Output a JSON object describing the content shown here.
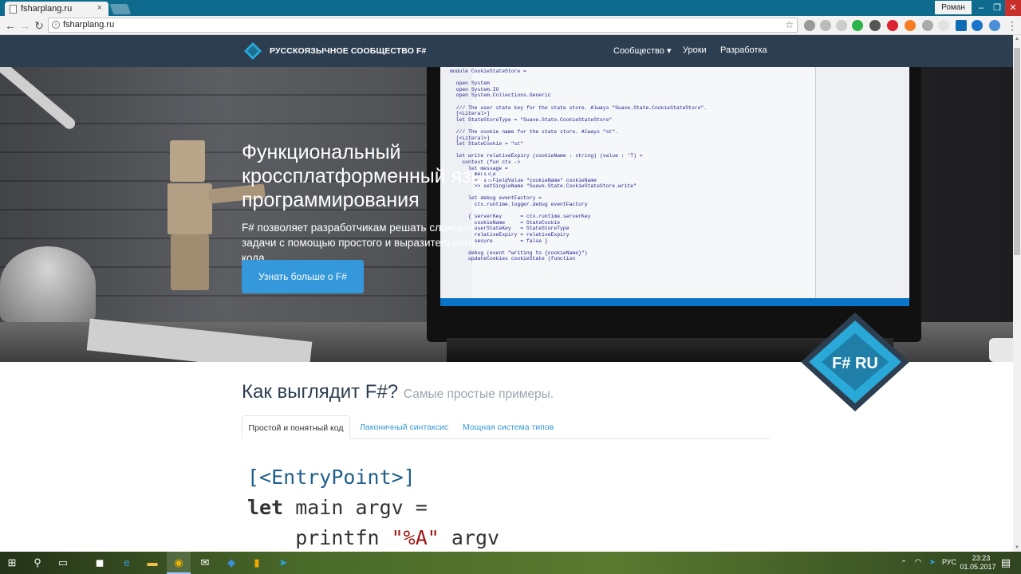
{
  "browser": {
    "tab_title": "fsharplang.ru",
    "url": "fsharplang.ru",
    "user_name": "Роман",
    "tab_close": "×",
    "window_controls": [
      "–",
      "❐",
      "✕"
    ]
  },
  "site": {
    "brand": "РУССКОЯЗЫЧНОЕ СООБЩЕСТВО F#",
    "logo_text": "F# RU",
    "nav": [
      {
        "label": "Сообщество ▾"
      },
      {
        "label": "Уроки"
      },
      {
        "label": "Разработка"
      }
    ]
  },
  "hero": {
    "title": "Функциональный кроссплатформенный язык программирования",
    "subtitle": "F# позволяет разработчикам решать сложные задачи с помощью простого и выразительного кода.",
    "button_label": "Узнать больше о F#",
    "badge_text": "F# RU"
  },
  "section": {
    "title": "Как выглядит F#?",
    "subtitle": "Самые простые примеры."
  },
  "tabs": [
    {
      "label": "Простой и понятный код",
      "active": true
    },
    {
      "label": "Лаконичный синтаксис",
      "active": false
    },
    {
      "label": "Мощная система типов",
      "active": false
    }
  ],
  "code_sample": {
    "line1": "[<EntryPoint>]",
    "line2_kw": "let",
    "line2_rest": " main argv =",
    "line3_fn": "    printfn ",
    "line3_str": "\"%A\"",
    "line3_rest": " argv"
  },
  "screen_code": "module CookieStateStore =\n\n  open System\n  open System.IO\n  open System.Collections.Generic\n\n  /// The user state key for the state store. Always \"Suave.State.CookieStateStore\".\n  [<Literal>]\n  let StateStoreType = \"Suave.State.CookieStateStore\"\n\n  /// The cookie name for the state store. Always \"st\".\n  [<Literal>]\n  let StateCookie = \"st\"\n\n  let write relativeExpiry (cookieName : string) (value : 'T) =\n    context (fun ctx ->\n      let message =\n        message\n        >> setFieldValue \"cookieName\" cookieName\n        >> setSingleName \"Suave.State.CookieStateStore.write\"\n\n      let debug eventFactory =\n        ctx.runtime.logger.debug eventFactory\n\n      { serverKey      = ctx.runtime.serverKey\n        cookieName     = StateCookie\n        userStateKey   = StateStoreType\n        relativeExpiry = relativeExpiry\n        secure         = false }\n\n      debug (event \"writing to {cookieName}\")\n      updateCookies cookieState (function",
  "taskbar": {
    "lang": "РУС",
    "time": "23:23",
    "date": "01.05.2017"
  },
  "colors": {
    "navbar": "#2c3e50",
    "accent": "#3498db",
    "badge": "#2aa8d8"
  }
}
